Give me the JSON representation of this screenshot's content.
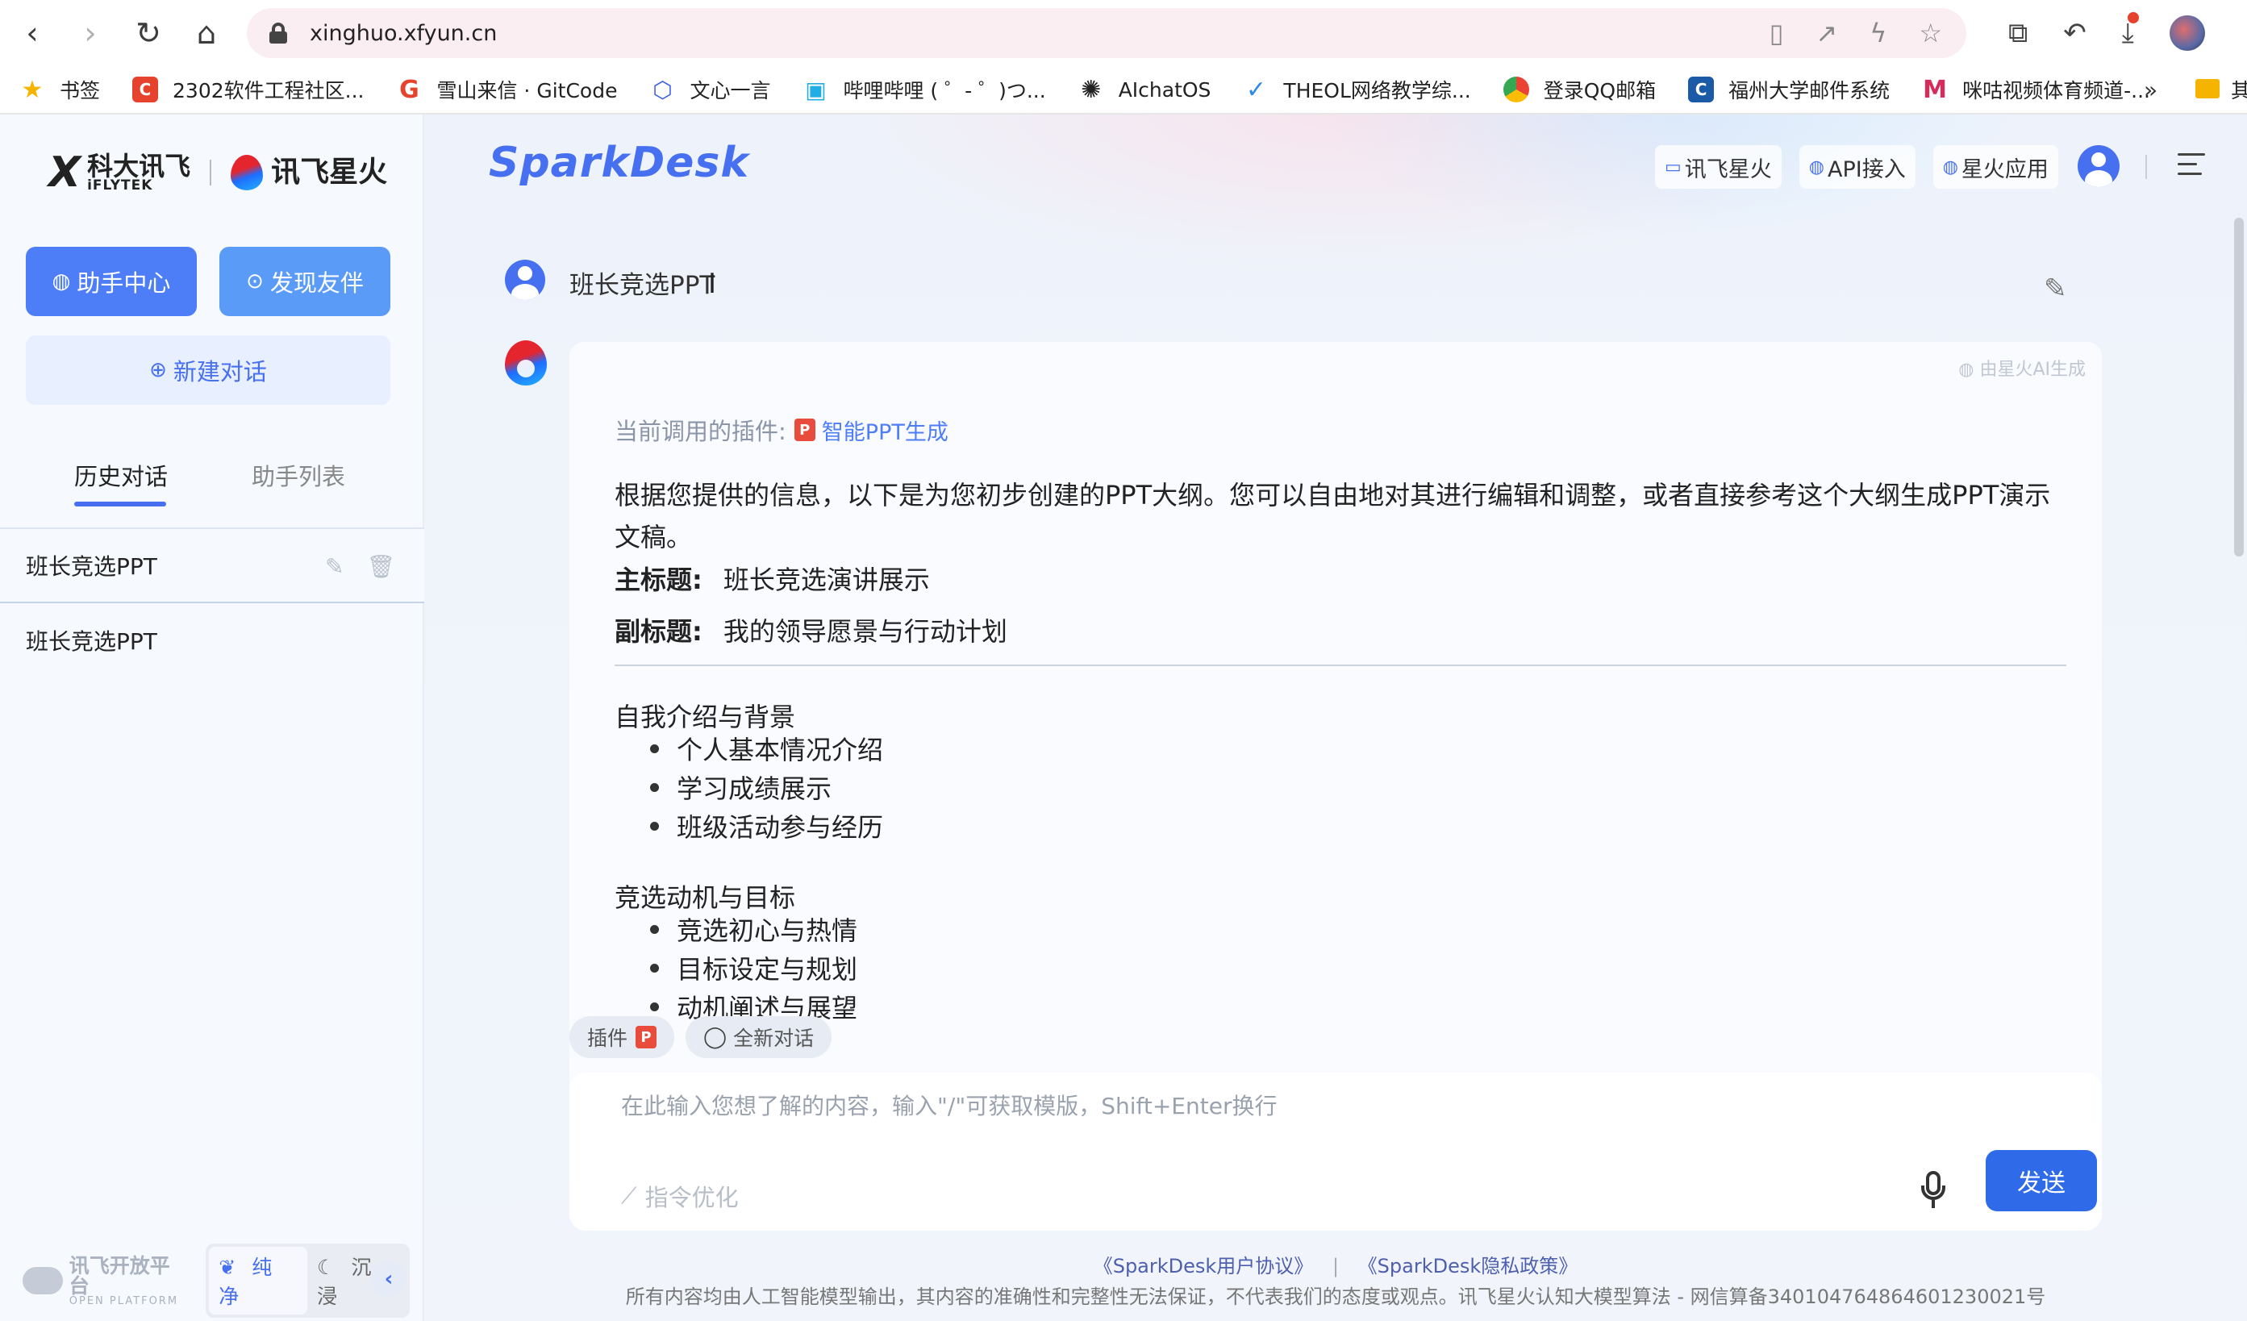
{
  "browser": {
    "url": "xinghuo.xfyun.cn",
    "bookmarks": [
      {
        "label": "书签",
        "icon": "star-icon",
        "color": "#f4b400"
      },
      {
        "label": "2302软件工程社区...",
        "icon": "csdn-icon",
        "color": "#e5432d"
      },
      {
        "label": "雪山来信 · GitCode",
        "icon": "gitcode-icon",
        "color": "#e5432d"
      },
      {
        "label": "文心一言",
        "icon": "wenxin-icon",
        "color": "#3a62e6"
      },
      {
        "label": "哔哩哔哩 ( ゜- ゜)つ...",
        "icon": "bilibili-icon",
        "color": "#23ade5"
      },
      {
        "label": "AIchatOS",
        "icon": "openai-icon",
        "color": "#222222"
      },
      {
        "label": "THEOL网络教学综...",
        "icon": "theol-icon",
        "color": "#2e8ae6"
      },
      {
        "label": "登录QQ邮箱",
        "icon": "chrome-icon",
        "color": "#f4b400"
      },
      {
        "label": "福州大学邮件系统",
        "icon": "fzu-mail-icon",
        "color": "#1a5aa6"
      },
      {
        "label": "咪咕视频体育频道-...",
        "icon": "migu-icon",
        "color": "#d62c5c"
      }
    ],
    "more_label": "»",
    "cut_label": "其"
  },
  "sidebar": {
    "brand_left_cn": "科大讯飞",
    "brand_left_en": "iFLYTEK",
    "brand_right_cn": "讯飞星火",
    "assist_label": "助手中心",
    "discover_label": "发现友伴",
    "new_chat_label": "新建对话",
    "tabs": [
      {
        "label": "历史对话",
        "active": true
      },
      {
        "label": "助手列表",
        "active": false
      }
    ],
    "history": [
      {
        "label": "班长竞选PPT"
      },
      {
        "label": "班长竞选PPT"
      }
    ],
    "footer": {
      "platform_cn": "讯飞开放平台",
      "platform_en": "OPEN PLATFORM",
      "mode_on": "纯净",
      "mode_off": "沉浸"
    }
  },
  "header": {
    "logo": "SparkDesk",
    "links": [
      {
        "label": "讯飞星火",
        "icon": "screen-icon"
      },
      {
        "label": "API接入",
        "icon": "spark-icon"
      },
      {
        "label": "星火应用",
        "icon": "spark-icon"
      }
    ]
  },
  "chat": {
    "question": "班长竞选PPT",
    "ai_tag": "由星火AI生成",
    "plugin_prefix": "当前调用的插件:",
    "plugin_name": "智能PPT生成",
    "intro": "根据您提供的信息，以下是为您初步创建的PPT大纲。您可以自由地对其进行编辑和调整，或者直接参考这个大纲生成PPT演示文稿。",
    "main_title_label": "主标题:",
    "main_title": "班长竞选演讲展示",
    "subtitle_label": "副标题:",
    "subtitle": "我的领导愿景与行动计划",
    "sections": [
      {
        "title": "自我介绍与背景",
        "items": [
          "个人基本情况介绍",
          "学习成绩展示",
          "班级活动参与经历"
        ]
      },
      {
        "title": "竞选动机与目标",
        "items": [
          "竞选初心与热情",
          "目标设定与规划",
          "动机阐述与展望"
        ]
      }
    ]
  },
  "composer": {
    "plugin_chip": "插件",
    "new_chat_chip": "全新对话",
    "placeholder": "在此输入您想了解的内容，输入\"/\"可获取模版，Shift+Enter换行",
    "optimize_label": "指令优化",
    "send_label": "发送"
  },
  "footer": {
    "agreement": "《SparkDesk用户协议》",
    "separator": "|",
    "privacy": "《SparkDesk隐私政策》",
    "disclaimer": "所有内容均由人工智能模型输出，其内容的准确性和完整性无法保证，不代表我们的态度或观点。讯飞星火认知大模型算法 - 网信算备340104764864601230021号"
  },
  "colors": {
    "accent": "#4670f0",
    "send": "#2f6be8",
    "ppt_red": "#e84c3d"
  }
}
